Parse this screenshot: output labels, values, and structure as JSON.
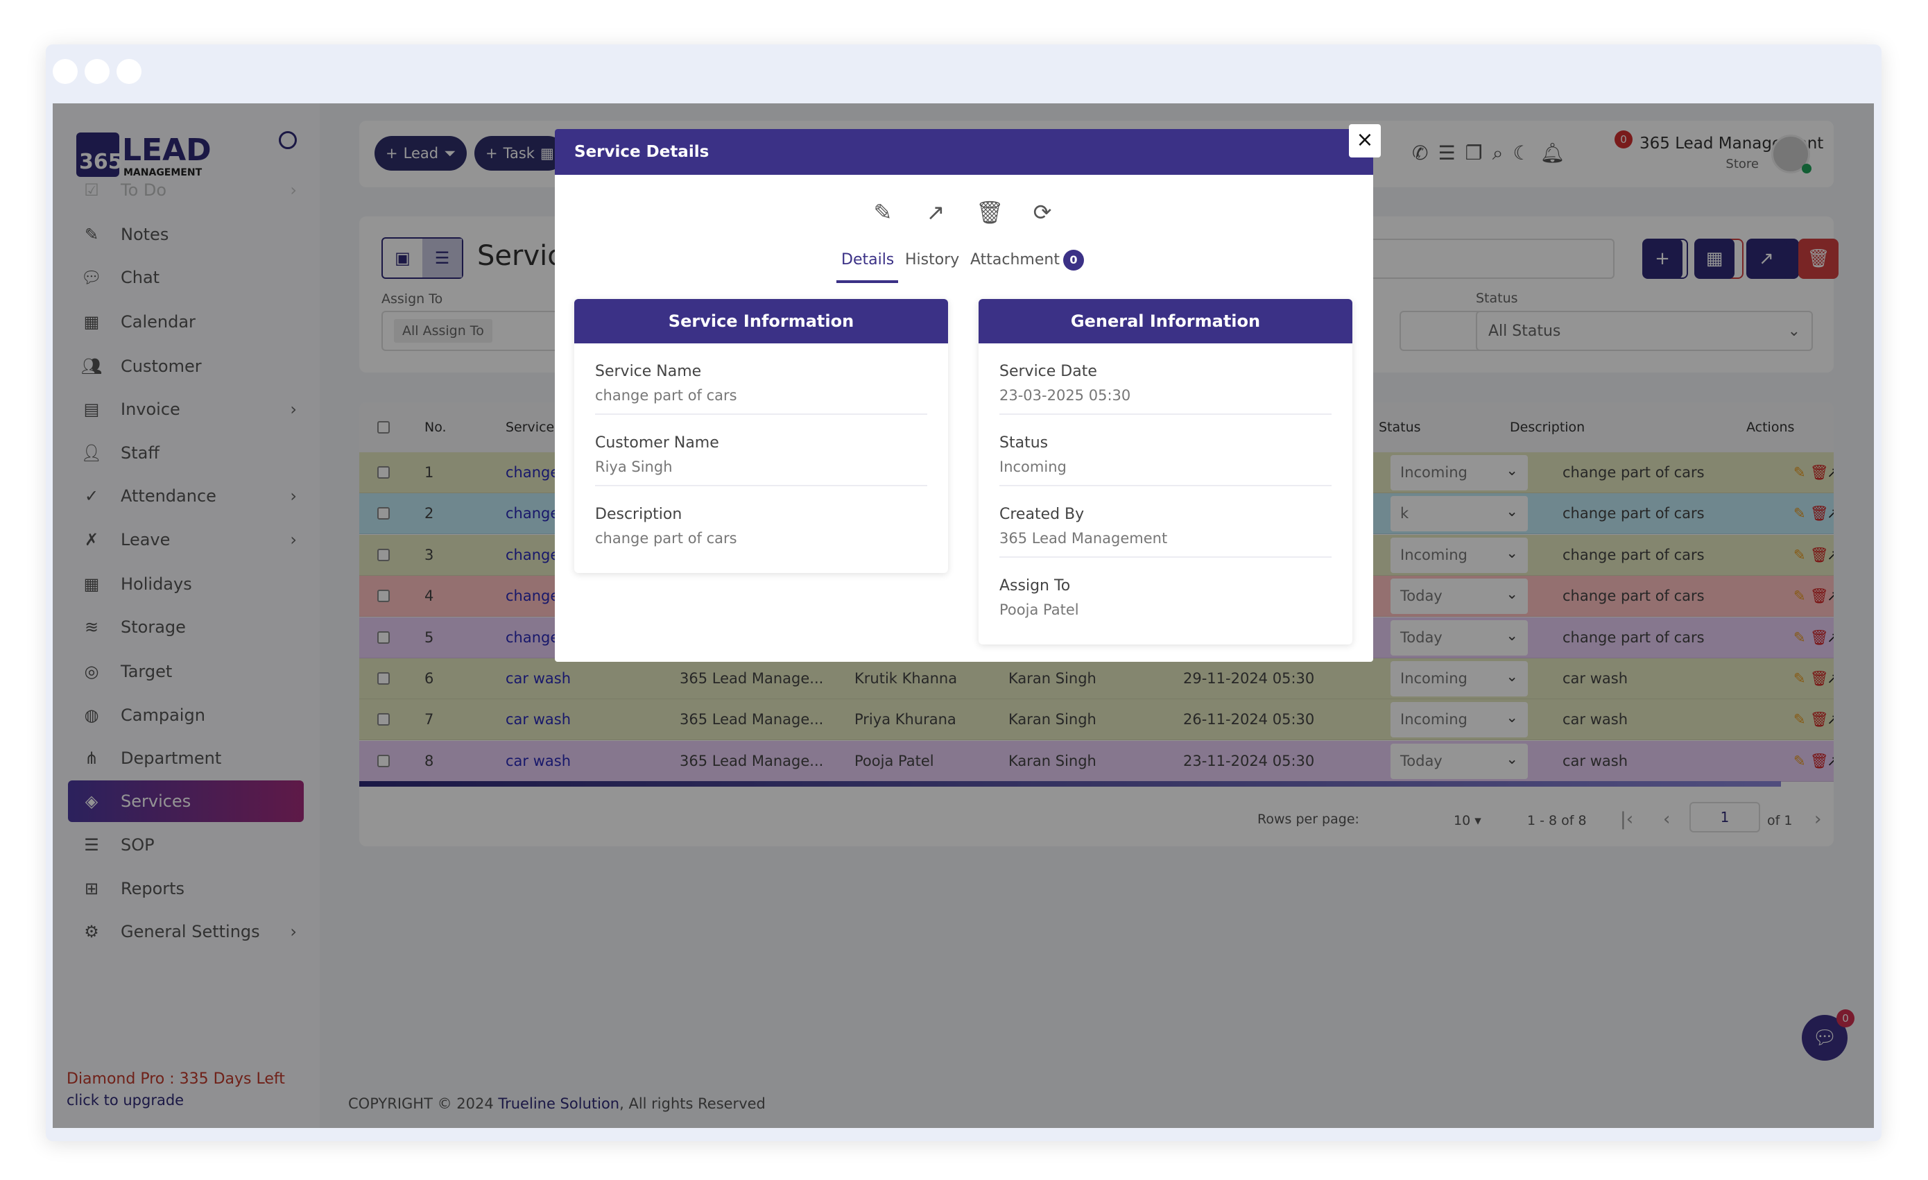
{
  "sidebar": {
    "logo_text": "365 LEAD MANAGEMENT",
    "items": [
      {
        "label": "To Do",
        "icon": "checklist-icon",
        "chevron": true
      },
      {
        "label": "Notes",
        "icon": "edit-icon"
      },
      {
        "label": "Chat",
        "icon": "chat-icon"
      },
      {
        "label": "Calendar",
        "icon": "calendar-icon"
      },
      {
        "label": "Customer",
        "icon": "users-icon"
      },
      {
        "label": "Invoice",
        "icon": "document-icon",
        "chevron": true
      },
      {
        "label": "Staff",
        "icon": "user-icon"
      },
      {
        "label": "Attendance",
        "icon": "check-circle-icon",
        "chevron": true
      },
      {
        "label": "Leave",
        "icon": "user-x-icon",
        "chevron": true
      },
      {
        "label": "Holidays",
        "icon": "calendar-icon"
      },
      {
        "label": "Storage",
        "icon": "database-icon"
      },
      {
        "label": "Target",
        "icon": "target-icon"
      },
      {
        "label": "Campaign",
        "icon": "globe-icon"
      },
      {
        "label": "Department",
        "icon": "hierarchy-icon"
      },
      {
        "label": "Services",
        "icon": "layers-icon",
        "active": true
      },
      {
        "label": "SOP",
        "icon": "list-icon"
      },
      {
        "label": "Reports",
        "icon": "grid-icon"
      },
      {
        "label": "General Settings",
        "icon": "gear-icon",
        "chevron": true
      }
    ],
    "plan_text": "Diamond Pro : 335 Days Left",
    "upgrade_text": "click to upgrade"
  },
  "topbar": {
    "lead_label": "Lead",
    "task_label": "Task",
    "notification_count": "0",
    "user_name": "365 Lead Management",
    "user_role": "Store"
  },
  "filters": {
    "page_title": "Services",
    "assign_to_label": "Assign To",
    "assign_to_chip": "All Assign To",
    "status_label": "Status",
    "status_value": "All Status"
  },
  "table": {
    "headers": {
      "no": "No.",
      "service": "Service",
      "status": "Status",
      "description": "Description",
      "actions": "Actions"
    },
    "rows": [
      {
        "no": "1",
        "service": "change part of cars",
        "created_by": "",
        "customer": "",
        "assign": "",
        "date": "",
        "status": "Incoming",
        "description": "change part of cars",
        "color": "#e4e7bf"
      },
      {
        "no": "2",
        "service": "change part of cars",
        "created_by": "",
        "customer": "",
        "assign": "",
        "date": "",
        "status": "k",
        "description": "change part of cars",
        "color": "#bfe8f4"
      },
      {
        "no": "3",
        "service": "change part of cars",
        "created_by": "",
        "customer": "",
        "assign": "",
        "date": "",
        "status": "Incoming",
        "description": "change part of cars",
        "color": "#e4e7bf"
      },
      {
        "no": "4",
        "service": "change part of cars",
        "created_by": "",
        "customer": "",
        "assign": "",
        "date": "",
        "status": "Today",
        "description": "change part of cars",
        "color": "#ffc2c2"
      },
      {
        "no": "5",
        "service": "change part of cars",
        "created_by": "",
        "customer": "",
        "assign": "",
        "date": "",
        "status": "Today",
        "description": "change part of cars",
        "color": "#e7cdf4"
      },
      {
        "no": "6",
        "service": "car wash",
        "created_by": "365 Lead Manage...",
        "customer": "Krutik Khanna",
        "assign": "Karan Singh",
        "date": "29-11-2024 05:30",
        "status": "Incoming",
        "description": "car wash",
        "color": "#e4e7bf"
      },
      {
        "no": "7",
        "service": "car wash",
        "created_by": "365 Lead Manage...",
        "customer": "Priya Khurana",
        "assign": "Karan Singh",
        "date": "26-11-2024 05:30",
        "status": "Incoming",
        "description": "car wash",
        "color": "#e4e7bf"
      },
      {
        "no": "8",
        "service": "car wash",
        "created_by": "365 Lead Manage...",
        "customer": "Pooja Patel",
        "assign": "Karan Singh",
        "date": "23-11-2024 05:30",
        "status": "Today",
        "description": "car wash",
        "color": "#e7cdf4"
      }
    ],
    "pagination": {
      "rows_per_page_label": "Rows per page:",
      "rows_per_page": "10",
      "range": "1 - 8 of 8",
      "page": "1",
      "of_pages": "of 1"
    }
  },
  "footer": {
    "copyright_prefix": "COPYRIGHT © 2024 ",
    "company": "Trueline Solution",
    "copyright_suffix": ", All rights Reserved"
  },
  "chat_badge": "0",
  "modal": {
    "title": "Service Details",
    "close": "×",
    "tabs": [
      {
        "label": "Details",
        "active": true
      },
      {
        "label": "History"
      },
      {
        "label": "Attachment",
        "badge": "0"
      }
    ],
    "service_info": {
      "title": "Service Information",
      "fields": [
        {
          "label": "Service Name",
          "value": "change part of cars"
        },
        {
          "label": "Customer Name",
          "value": "Riya Singh"
        },
        {
          "label": "Description",
          "value": "change part of cars"
        }
      ]
    },
    "general_info": {
      "title": "General Information",
      "fields": [
        {
          "label": "Service Date",
          "value": "23-03-2025 05:30"
        },
        {
          "label": "Status",
          "value": "Incoming"
        },
        {
          "label": "Created By",
          "value": "365 Lead Management"
        },
        {
          "label": "Assign To",
          "value": "Pooja Patel"
        }
      ]
    }
  },
  "colors": {
    "primary": "#3b3186",
    "danger": "#c0392b",
    "accent": "#a32c7c"
  }
}
